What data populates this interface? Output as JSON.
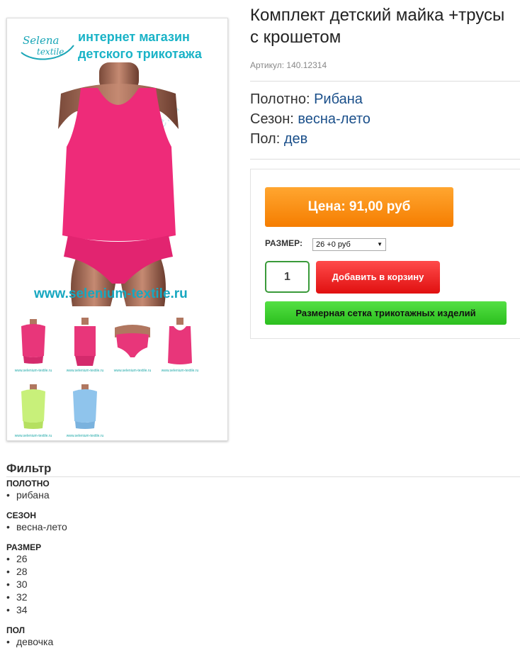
{
  "product": {
    "title": "Комплект детский майка +трусы с крошетом",
    "sku": "Артикул: 140.12314",
    "attributes": [
      {
        "label": "Полотно:",
        "value": "Рибана"
      },
      {
        "label": "Сезон:",
        "value": "весна-лето"
      },
      {
        "label": "Пол:",
        "value": "дев"
      }
    ]
  },
  "gallery": {
    "logo_name": "Selena",
    "logo_sub": "textile",
    "banner_line1": "интернет магазин",
    "banner_line2": "детского трикотажа",
    "site_url": "www.selenium-textile.ru",
    "watermark": "www.selenium-textile.ru",
    "thumb_caption": "www.selenium-textile.ru",
    "thumbnails": [
      {
        "color": "#e8367a",
        "item": "set"
      },
      {
        "color": "#e8367a",
        "item": "set-back"
      },
      {
        "color": "#e8367a",
        "item": "briefs"
      },
      {
        "color": "#e8367a",
        "item": "tank"
      },
      {
        "color": "#c8f07a",
        "item": "set"
      },
      {
        "color": "#8fc4ec",
        "item": "set"
      }
    ],
    "main_color": "#ee2b79"
  },
  "buy": {
    "price_label": "Цена: 91,00 руб",
    "size_label": "РАЗМЕР:",
    "size_selected": "26 +0 руб",
    "quantity": "1",
    "add_to_cart": "Добавить в корзину",
    "size_chart": "Размерная сетка трикотажных изделий"
  },
  "filter": {
    "title": "Фильтр",
    "groups": [
      {
        "title": "ПОЛОТНО",
        "items": [
          "рибана"
        ]
      },
      {
        "title": "СЕЗОН",
        "items": [
          "весна-лето"
        ]
      },
      {
        "title": "РАЗМЕР",
        "items": [
          "26",
          "28",
          "30",
          "32",
          "34"
        ]
      },
      {
        "title": "ПОЛ",
        "items": [
          "девочка"
        ]
      }
    ]
  }
}
